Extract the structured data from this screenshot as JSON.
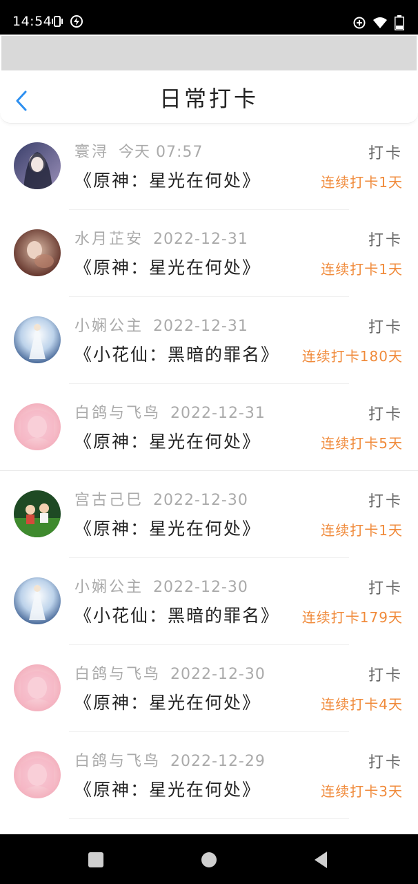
{
  "status_bar": {
    "time": "14:54",
    "battery_level": "15"
  },
  "header": {
    "title": "日常打卡"
  },
  "colors": {
    "accent": "#2d8ff0",
    "streak": "#f08a3a",
    "meta": "#aaaaaa"
  },
  "items": [
    {
      "name": "寰浔",
      "date": "今天 07:57",
      "book": "《原神：星光在何处》",
      "action": "打卡",
      "streak": "连续打卡1天",
      "avatar": "avatar-dark-hair"
    },
    {
      "name": "水月芷安",
      "date": "2022-12-31",
      "book": "《原神：星光在何处》",
      "action": "打卡",
      "streak": "连续打卡1天",
      "avatar": "avatar-brown"
    },
    {
      "name": "小娴公主",
      "date": "2022-12-31",
      "book": "《小花仙：黑暗的罪名》",
      "action": "打卡",
      "streak": "连续打卡180天",
      "avatar": "avatar-fairy"
    },
    {
      "name": "白鸽与飞鸟",
      "date": "2022-12-31",
      "book": "《原神：星光在何处》",
      "action": "打卡",
      "streak": "连续打卡5天",
      "avatar": "avatar-pink"
    },
    {
      "name": "宫古己巳",
      "date": "2022-12-30",
      "book": "《原神：星光在何处》",
      "action": "打卡",
      "streak": "连续打卡1天",
      "avatar": "avatar-kids"
    },
    {
      "name": "小娴公主",
      "date": "2022-12-30",
      "book": "《小花仙：黑暗的罪名》",
      "action": "打卡",
      "streak": "连续打卡179天",
      "avatar": "avatar-fairy"
    },
    {
      "name": "白鸽与飞鸟",
      "date": "2022-12-30",
      "book": "《原神：星光在何处》",
      "action": "打卡",
      "streak": "连续打卡4天",
      "avatar": "avatar-pink"
    },
    {
      "name": "白鸽与飞鸟",
      "date": "2022-12-29",
      "book": "《原神：星光在何处》",
      "action": "打卡",
      "streak": "连续打卡3天",
      "avatar": "avatar-pink"
    }
  ]
}
